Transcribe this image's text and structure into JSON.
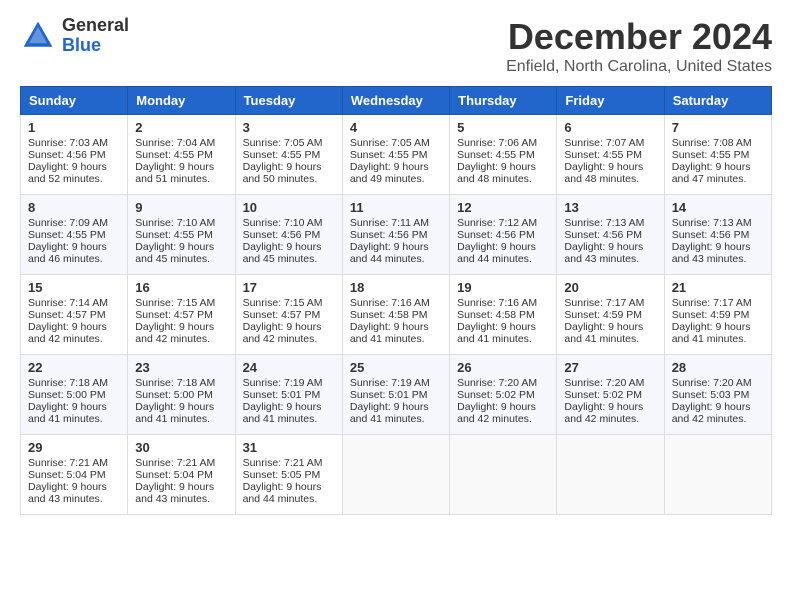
{
  "logo": {
    "general": "General",
    "blue": "Blue"
  },
  "title": "December 2024",
  "location": "Enfield, North Carolina, United States",
  "days_of_week": [
    "Sunday",
    "Monday",
    "Tuesday",
    "Wednesday",
    "Thursday",
    "Friday",
    "Saturday"
  ],
  "weeks": [
    [
      {
        "day": "1",
        "sunrise": "Sunrise: 7:03 AM",
        "sunset": "Sunset: 4:56 PM",
        "daylight": "Daylight: 9 hours and 52 minutes."
      },
      {
        "day": "2",
        "sunrise": "Sunrise: 7:04 AM",
        "sunset": "Sunset: 4:55 PM",
        "daylight": "Daylight: 9 hours and 51 minutes."
      },
      {
        "day": "3",
        "sunrise": "Sunrise: 7:05 AM",
        "sunset": "Sunset: 4:55 PM",
        "daylight": "Daylight: 9 hours and 50 minutes."
      },
      {
        "day": "4",
        "sunrise": "Sunrise: 7:05 AM",
        "sunset": "Sunset: 4:55 PM",
        "daylight": "Daylight: 9 hours and 49 minutes."
      },
      {
        "day": "5",
        "sunrise": "Sunrise: 7:06 AM",
        "sunset": "Sunset: 4:55 PM",
        "daylight": "Daylight: 9 hours and 48 minutes."
      },
      {
        "day": "6",
        "sunrise": "Sunrise: 7:07 AM",
        "sunset": "Sunset: 4:55 PM",
        "daylight": "Daylight: 9 hours and 48 minutes."
      },
      {
        "day": "7",
        "sunrise": "Sunrise: 7:08 AM",
        "sunset": "Sunset: 4:55 PM",
        "daylight": "Daylight: 9 hours and 47 minutes."
      }
    ],
    [
      {
        "day": "8",
        "sunrise": "Sunrise: 7:09 AM",
        "sunset": "Sunset: 4:55 PM",
        "daylight": "Daylight: 9 hours and 46 minutes."
      },
      {
        "day": "9",
        "sunrise": "Sunrise: 7:10 AM",
        "sunset": "Sunset: 4:55 PM",
        "daylight": "Daylight: 9 hours and 45 minutes."
      },
      {
        "day": "10",
        "sunrise": "Sunrise: 7:10 AM",
        "sunset": "Sunset: 4:56 PM",
        "daylight": "Daylight: 9 hours and 45 minutes."
      },
      {
        "day": "11",
        "sunrise": "Sunrise: 7:11 AM",
        "sunset": "Sunset: 4:56 PM",
        "daylight": "Daylight: 9 hours and 44 minutes."
      },
      {
        "day": "12",
        "sunrise": "Sunrise: 7:12 AM",
        "sunset": "Sunset: 4:56 PM",
        "daylight": "Daylight: 9 hours and 44 minutes."
      },
      {
        "day": "13",
        "sunrise": "Sunrise: 7:13 AM",
        "sunset": "Sunset: 4:56 PM",
        "daylight": "Daylight: 9 hours and 43 minutes."
      },
      {
        "day": "14",
        "sunrise": "Sunrise: 7:13 AM",
        "sunset": "Sunset: 4:56 PM",
        "daylight": "Daylight: 9 hours and 43 minutes."
      }
    ],
    [
      {
        "day": "15",
        "sunrise": "Sunrise: 7:14 AM",
        "sunset": "Sunset: 4:57 PM",
        "daylight": "Daylight: 9 hours and 42 minutes."
      },
      {
        "day": "16",
        "sunrise": "Sunrise: 7:15 AM",
        "sunset": "Sunset: 4:57 PM",
        "daylight": "Daylight: 9 hours and 42 minutes."
      },
      {
        "day": "17",
        "sunrise": "Sunrise: 7:15 AM",
        "sunset": "Sunset: 4:57 PM",
        "daylight": "Daylight: 9 hours and 42 minutes."
      },
      {
        "day": "18",
        "sunrise": "Sunrise: 7:16 AM",
        "sunset": "Sunset: 4:58 PM",
        "daylight": "Daylight: 9 hours and 41 minutes."
      },
      {
        "day": "19",
        "sunrise": "Sunrise: 7:16 AM",
        "sunset": "Sunset: 4:58 PM",
        "daylight": "Daylight: 9 hours and 41 minutes."
      },
      {
        "day": "20",
        "sunrise": "Sunrise: 7:17 AM",
        "sunset": "Sunset: 4:59 PM",
        "daylight": "Daylight: 9 hours and 41 minutes."
      },
      {
        "day": "21",
        "sunrise": "Sunrise: 7:17 AM",
        "sunset": "Sunset: 4:59 PM",
        "daylight": "Daylight: 9 hours and 41 minutes."
      }
    ],
    [
      {
        "day": "22",
        "sunrise": "Sunrise: 7:18 AM",
        "sunset": "Sunset: 5:00 PM",
        "daylight": "Daylight: 9 hours and 41 minutes."
      },
      {
        "day": "23",
        "sunrise": "Sunrise: 7:18 AM",
        "sunset": "Sunset: 5:00 PM",
        "daylight": "Daylight: 9 hours and 41 minutes."
      },
      {
        "day": "24",
        "sunrise": "Sunrise: 7:19 AM",
        "sunset": "Sunset: 5:01 PM",
        "daylight": "Daylight: 9 hours and 41 minutes."
      },
      {
        "day": "25",
        "sunrise": "Sunrise: 7:19 AM",
        "sunset": "Sunset: 5:01 PM",
        "daylight": "Daylight: 9 hours and 41 minutes."
      },
      {
        "day": "26",
        "sunrise": "Sunrise: 7:20 AM",
        "sunset": "Sunset: 5:02 PM",
        "daylight": "Daylight: 9 hours and 42 minutes."
      },
      {
        "day": "27",
        "sunrise": "Sunrise: 7:20 AM",
        "sunset": "Sunset: 5:02 PM",
        "daylight": "Daylight: 9 hours and 42 minutes."
      },
      {
        "day": "28",
        "sunrise": "Sunrise: 7:20 AM",
        "sunset": "Sunset: 5:03 PM",
        "daylight": "Daylight: 9 hours and 42 minutes."
      }
    ],
    [
      {
        "day": "29",
        "sunrise": "Sunrise: 7:21 AM",
        "sunset": "Sunset: 5:04 PM",
        "daylight": "Daylight: 9 hours and 43 minutes."
      },
      {
        "day": "30",
        "sunrise": "Sunrise: 7:21 AM",
        "sunset": "Sunset: 5:04 PM",
        "daylight": "Daylight: 9 hours and 43 minutes."
      },
      {
        "day": "31",
        "sunrise": "Sunrise: 7:21 AM",
        "sunset": "Sunset: 5:05 PM",
        "daylight": "Daylight: 9 hours and 44 minutes."
      },
      null,
      null,
      null,
      null
    ]
  ]
}
